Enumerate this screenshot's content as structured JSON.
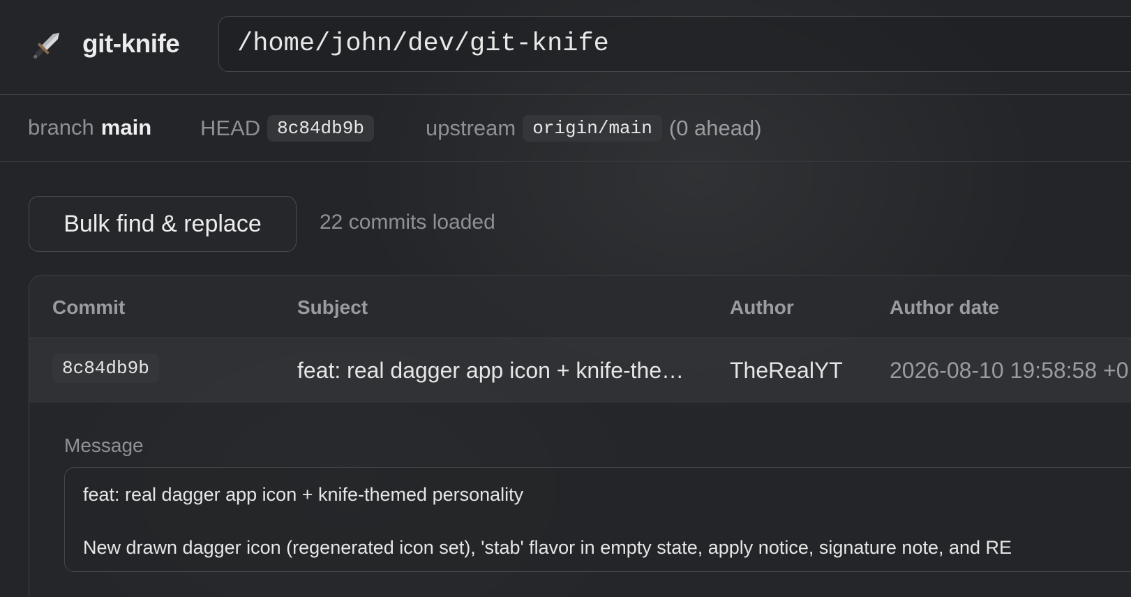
{
  "header": {
    "app_title": "git-knife",
    "app_icon": "dagger-icon",
    "repo_path": "/home/john/dev/git-knife"
  },
  "info": {
    "branch_label": "branch",
    "branch_value": "main",
    "head_label": "HEAD",
    "head_value": "8c84db9b",
    "upstream_label": "upstream",
    "upstream_value": "origin/main",
    "ahead_text": "(0 ahead)"
  },
  "actions": {
    "bulk_button": "Bulk find & replace",
    "commits_loaded": "22 commits loaded"
  },
  "table": {
    "columns": [
      "Commit",
      "Subject",
      "Author",
      "Author date"
    ],
    "rows": [
      {
        "commit": "8c84db9b",
        "subject": "feat: real dagger app icon + knife-themed personality",
        "author": "TheRealYT",
        "date": "2026-08-10 19:58:58 +0"
      }
    ]
  },
  "detail": {
    "message_label": "Message",
    "message": "feat: real dagger app icon + knife-themed personality\n\nNew drawn dagger icon (regenerated icon set), 'stab' flavor in empty state, apply notice, signature note, and RE"
  },
  "colors": {
    "background": "#232528",
    "border": "#3e4044",
    "muted_text": "#8f9195",
    "primary_text": "#e6e6e6"
  }
}
